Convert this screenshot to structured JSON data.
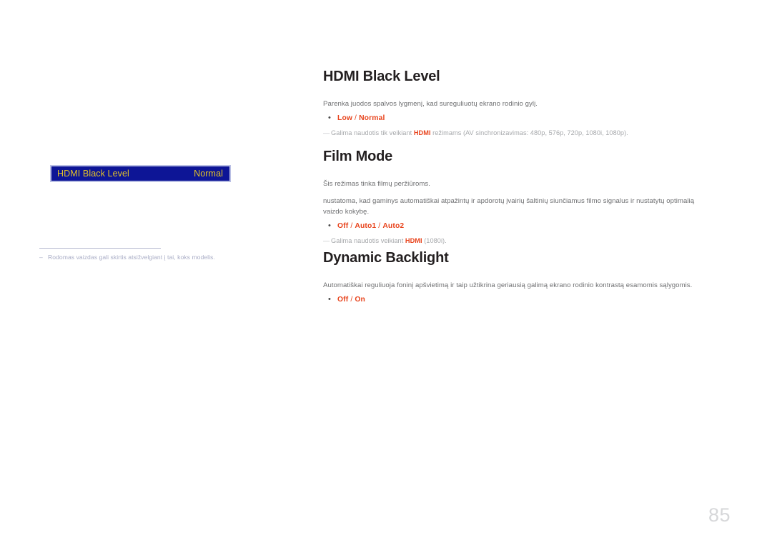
{
  "page": {
    "number": "85",
    "language": "lt"
  },
  "osd_widget": {
    "label": "HDMI Black Level",
    "value": "Normal"
  },
  "left_footnote": {
    "dash": "–",
    "text": "Rodomas vaizdas gali skirtis atsižvelgiant į tai, koks modelis."
  },
  "sections": [
    {
      "id": "hdmi-black-level",
      "heading": "HDMI Black Level",
      "paragraphs": [
        "Parenka juodos spalvos lygmenį, kad sureguliuotų ekrano rodinio gylį."
      ],
      "bullet": {
        "marker": "•",
        "options": [
          "Low",
          "Normal"
        ],
        "separator": " / "
      },
      "note": {
        "dash": "—",
        "before": "Galima naudotis tik veikiant ",
        "highlight": "HDMI",
        "after": " režimams (AV sinchronizavimas: 480p, 576p, 720p, 1080i, 1080p)."
      }
    },
    {
      "id": "film-mode",
      "heading": "Film Mode",
      "paragraphs": [
        "Šis režimas tinka filmų peržiūroms.",
        "nustatoma, kad gaminys automatiškai atpažintų ir apdorotų įvairių šaltinių siunčiamus filmo signalus ir nustatytų optimalią vaizdo kokybę."
      ],
      "bullet": {
        "marker": "•",
        "options": [
          "Off",
          "Auto1",
          "Auto2"
        ],
        "separator": " / "
      },
      "note": {
        "dash": "—",
        "before": "Galima naudotis veikiant ",
        "highlight": "HDMI",
        "after": " (1080i)."
      }
    },
    {
      "id": "dynamic-backlight",
      "heading": "Dynamic Backlight",
      "paragraphs": [
        "Automatiškai reguliuoja foninį apšvietimą ir taip užtikrina geriausią galimą ekrano rodinio kontrastą esamomis sąlygomis."
      ],
      "bullet": {
        "marker": "•",
        "options": [
          "Off",
          "On"
        ],
        "separator": " / "
      },
      "note": null
    }
  ],
  "colors": {
    "accent_orange": "#e8441d",
    "osd_background": "#0d1596",
    "osd_text": "#e3c228",
    "osd_border": "#b9bfe4",
    "body_text": "#6f7072",
    "heading_text": "#231f20",
    "note_text": "#a6a8ab",
    "page_number": "#d6d7d9"
  }
}
